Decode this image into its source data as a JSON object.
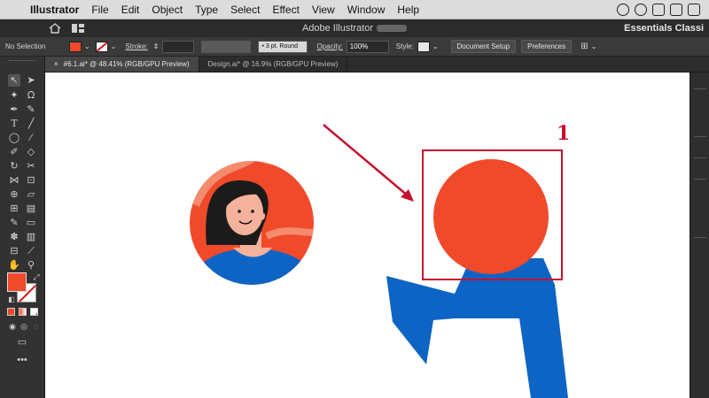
{
  "menubar": {
    "apple_icon": "apple-icon",
    "app_name": "Illustrator",
    "items": [
      "File",
      "Edit",
      "Object",
      "Type",
      "Select",
      "Effect",
      "View",
      "Window",
      "Help"
    ]
  },
  "titlebar": {
    "title": "Adobe Illustrator",
    "workspace": "Essentials Classi"
  },
  "controlbar": {
    "selection_label": "No Selection",
    "fill_color": "#f04a2b",
    "stroke_label": "Stroke:",
    "brush_value": "3 pt. Round",
    "opacity_label": "Opacity:",
    "opacity_value": "100%",
    "style_label": "Style:",
    "document_setup": "Document Setup",
    "preferences": "Preferences"
  },
  "tabs": [
    {
      "label": "#6.1.ai* @ 48.41% (RGB/GPU Preview)",
      "active": true
    },
    {
      "label": "Design.ai* @ 16.9% (RGB/GPU Preview)",
      "active": false
    }
  ],
  "colors": {
    "orange": "#f04a2b",
    "blue": "#0d64c4",
    "annotation_red": "#c8102e"
  },
  "annotation": {
    "label": "1"
  }
}
